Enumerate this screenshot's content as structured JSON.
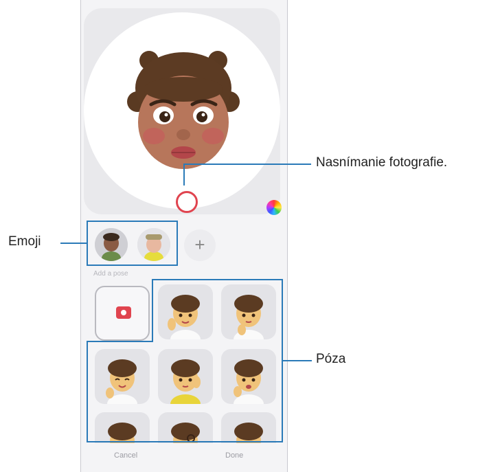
{
  "preview": {
    "shutter_label": "Nasnímanie fotografie."
  },
  "emoji_strip": {
    "label": "Emoji",
    "add_symbol": "+"
  },
  "pose_section": {
    "heading": "Add a pose",
    "label": "Póza"
  },
  "bottom_bar": {
    "cancel_label": "Cancel",
    "done_label": "Done"
  },
  "colors": {
    "accent": "#2a7ab8",
    "shutter_ring": "#e0444f",
    "camera_icon": "#e0444f"
  }
}
